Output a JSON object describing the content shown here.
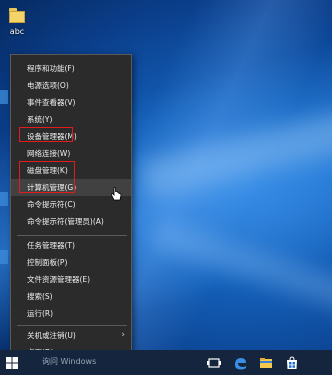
{
  "desktop": {
    "icon_label": "abc"
  },
  "context_menu": {
    "items": [
      {
        "label": "程序和功能(F)"
      },
      {
        "label": "电源选项(O)"
      },
      {
        "label": "事件查看器(V)"
      },
      {
        "label": "系统(Y)"
      },
      {
        "label": "设备管理器(M)"
      },
      {
        "label": "网络连接(W)"
      },
      {
        "label": "磁盘管理(K)"
      },
      {
        "label": "计算机管理(G)"
      },
      {
        "label": "命令提示符(C)"
      },
      {
        "label": "命令提示符(管理员)(A)"
      },
      {
        "label": "任务管理器(T)"
      },
      {
        "label": "控制面板(P)"
      },
      {
        "label": "文件资源管理器(E)"
      },
      {
        "label": "搜索(S)"
      },
      {
        "label": "运行(R)"
      },
      {
        "label": "关机或注销(U)"
      },
      {
        "label": "桌面(D)"
      }
    ],
    "hover_item": "计算机管理(G)",
    "highlighted_items": [
      "设备管理器(M)",
      "磁盘管理(K)",
      "计算机管理(G)"
    ],
    "highlight_color": "#e21b1b"
  },
  "taskbar": {
    "search_text": "询问 Windows"
  },
  "colors": {
    "menu_bg": "#2b2b2b",
    "taskbar_bg": "#15253d",
    "accent": "#1e6fd0"
  }
}
